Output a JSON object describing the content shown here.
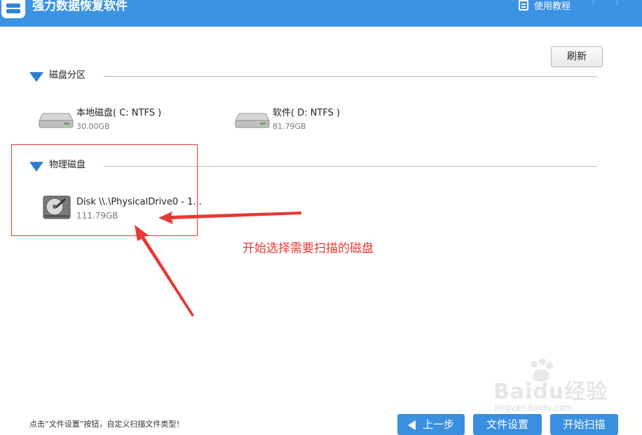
{
  "header": {
    "app_title": "强力数据恢复软件",
    "help_label": "使用教程",
    "accent_color": "#3b93e3"
  },
  "toolbar": {
    "refresh_label": "刷新"
  },
  "partitions": {
    "title": "磁盘分区",
    "drives": [
      {
        "name": "本地磁盘( C: NTFS )",
        "size": "30.00GB",
        "icon": "hard-drive-icon"
      },
      {
        "name": "软件( D: NTFS )",
        "size": "81.79GB",
        "icon": "hard-drive-icon"
      }
    ]
  },
  "physical": {
    "title": "物理磁盘",
    "disks": [
      {
        "name": "Disk \\\\.\\PhysicalDrive0 - 1...",
        "size": "111.79GB",
        "icon": "physical-disk-icon"
      }
    ]
  },
  "annotation": {
    "text": "开始选择需要扫描的磁盘",
    "color": "#e53935"
  },
  "footer": {
    "hint": "点击“文件设置”按钮，自定义扫描文件类型！",
    "back_label": "上一步",
    "file_settings_label": "文件设置",
    "start_scan_label": "开始扫描"
  },
  "watermark": {
    "logo": "Baidu经验",
    "url": "jingyan.baidu.com"
  }
}
